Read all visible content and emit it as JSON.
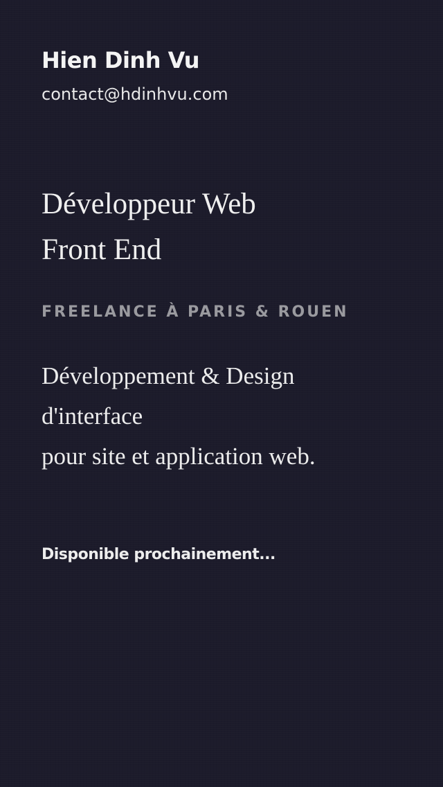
{
  "header": {
    "name": "Hien Dinh Vu",
    "email": "contact@hdinhvu.com"
  },
  "hero": {
    "title_line1": "Développeur Web",
    "title_line2": "Front End",
    "location": "FREELANCE À PARIS & ROUEN",
    "description_line1": "Développement & Design",
    "description_line2": "d'interface",
    "description_line3": "pour site et application web."
  },
  "footer": {
    "availability": "Disponible prochainement..."
  },
  "colors": {
    "background": "#1c1b2b",
    "text": "#f2f2f2",
    "muted": "#9a9a9f"
  }
}
